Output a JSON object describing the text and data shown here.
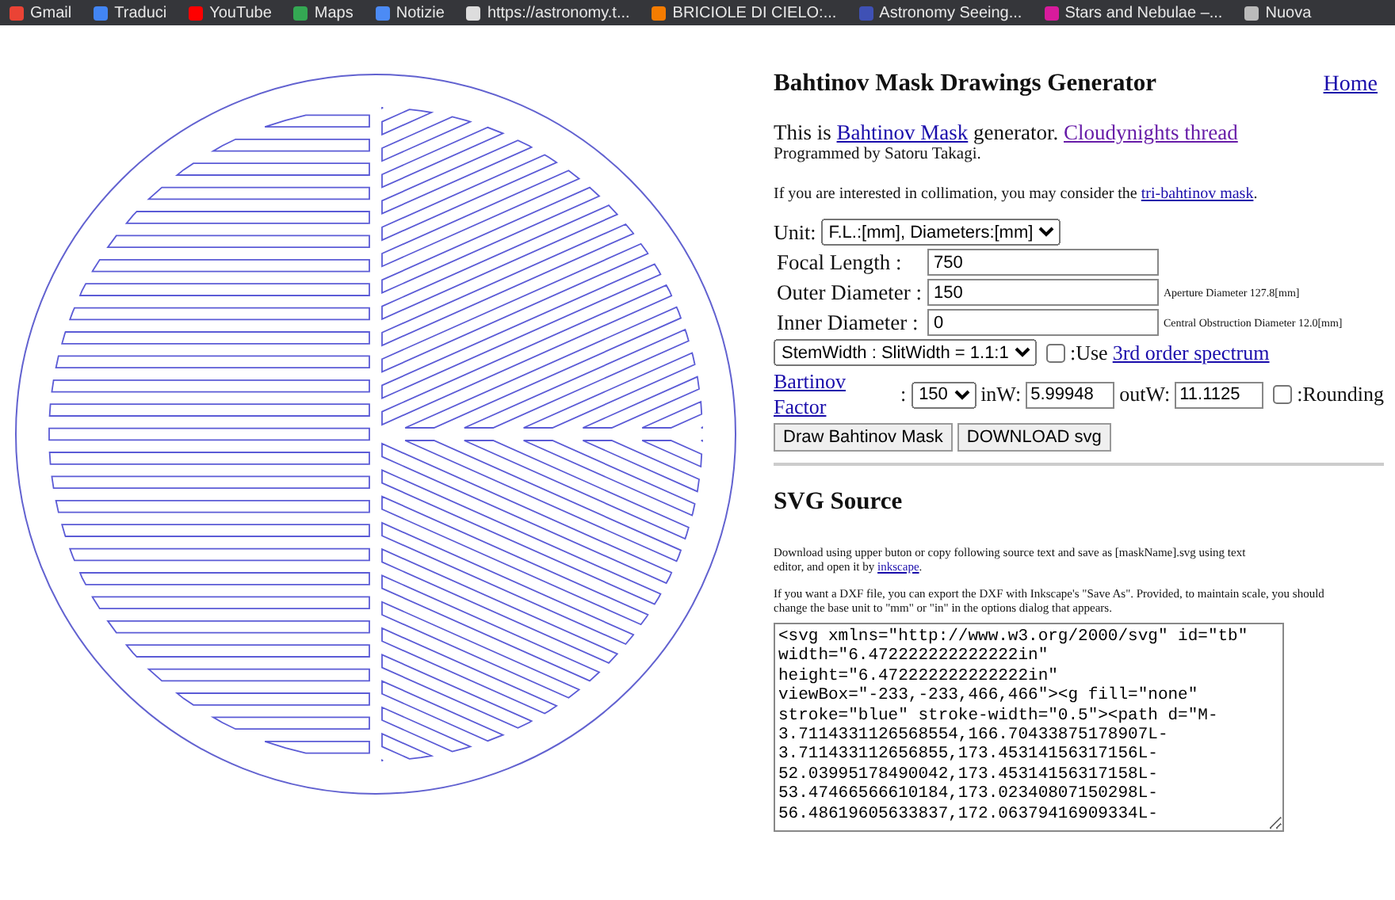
{
  "bookmarks": [
    {
      "label": "Gmail",
      "color": "#ea4335"
    },
    {
      "label": "Traduci",
      "color": "#4285f4"
    },
    {
      "label": "YouTube",
      "color": "#ff0000"
    },
    {
      "label": "Maps",
      "color": "#34a853"
    },
    {
      "label": "Notizie",
      "color": "#4c8bf5"
    },
    {
      "label": "https://astronomy.t...",
      "color": "#dddddd"
    },
    {
      "label": "BRICIOLE DI CIELO:...",
      "color": "#f57c00"
    },
    {
      "label": "Astronomy Seeing...",
      "color": "#3f51b5"
    },
    {
      "label": "Stars and Nebulae –...",
      "color": "#d81b9c"
    },
    {
      "label": "Nuova",
      "color": "#bbbbbb"
    }
  ],
  "title": "Bahtinov Mask Drawings Generator",
  "home_link": "Home",
  "intro": [
    {
      "kind": "text",
      "text": "This is "
    },
    {
      "kind": "link",
      "text": "Bahtinov Mask",
      "visited": false
    },
    {
      "kind": "text",
      "text": " generator. "
    },
    {
      "kind": "link",
      "text": "Cloudynights thread",
      "visited": true
    }
  ],
  "author": "Programmed by Satoru Takagi.",
  "collimation": [
    {
      "kind": "text",
      "text": "If you are interested in collimation, you may consider the "
    },
    {
      "kind": "link",
      "text": "tri-bahtinov mask",
      "visited": false
    },
    {
      "kind": "text",
      "text": "."
    }
  ],
  "unit": {
    "label": "Unit:",
    "value": "F.L.:[mm], Diameters:[mm]"
  },
  "fields": [
    {
      "label": "Focal Length :",
      "value": "750"
    },
    {
      "label": "Outer Diameter :",
      "value": "150",
      "note": "Aperture Diameter 127.8[mm]"
    },
    {
      "label": "Inner Diameter :",
      "value": "0",
      "note": "Central Obstruction Diameter 12.0[mm]"
    }
  ],
  "ratio": {
    "value": "StemWidth : SlitWidth = 1.1:1",
    "checkbox": {
      "checked": false,
      "label": ":Use"
    },
    "link": "3rd order spectrum"
  },
  "factor": {
    "link": "Bartinov Factor",
    "colon": ":",
    "value": "150",
    "inw_label": "inW:",
    "inw": "5.99948",
    "outw_label": "outW:",
    "outw": "11.1125",
    "rounding": {
      "checked": false,
      "label": ":Rounding"
    }
  },
  "buttons": [
    "Draw Bahtinov Mask",
    "DOWNLOAD svg"
  ],
  "source_heading": "SVG Source",
  "download_note": [
    {
      "kind": "text",
      "text": "Download using upper buton or copy following source text and save as [maskName].svg using text editor, and open it by "
    },
    {
      "kind": "link",
      "text": "inkscape",
      "visited": false
    },
    {
      "kind": "text",
      "text": "."
    }
  ],
  "dxf_note": "If you want a DXF file, you can export the DXF with Inkscape's \"Save As\". Provided, to maintain scale, you should change the base unit to \"mm\" or \"in\" in the options dialog that appears.",
  "source_lines": [
    "<svg xmlns=\"http://www.w3.org/2000/svg\" id=\"tb\"",
    "width=\"6.472222222222222in\"",
    "height=\"6.472222222222222in\"",
    "viewBox=\"-233,-233,466,466\"><g fill=\"none\"",
    "stroke=\"blue\" stroke-width=\"0.5\"><path d=\"M-",
    "3.7114331126568554,166.70433875178907L-",
    "3.711433112656855,173.45314156317156L-",
    "52.03995178490042,173.45314156317158L-",
    "53.47466566610184,173.02340807150298L-",
    "56.48619605633837,172.06379416909334L-"
  ]
}
